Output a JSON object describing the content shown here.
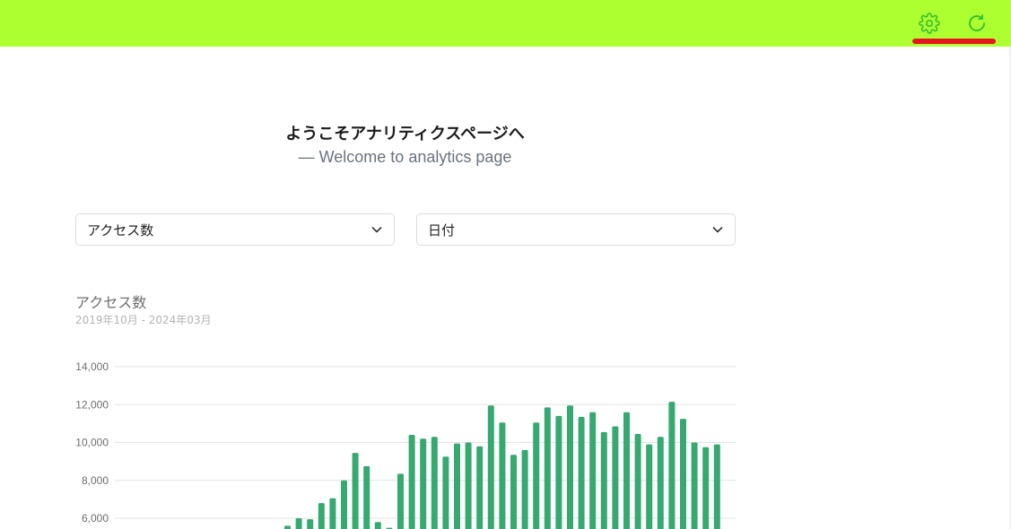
{
  "header": {
    "settings_icon": "gear-icon",
    "refresh_icon": "refresh-icon",
    "bg_color": "#adff2f",
    "icon_color": "#2fbf2f",
    "underline_color": "#e4161b"
  },
  "main": {
    "title": "ようこそアナリティクスページへ",
    "subtitle": "—  Welcome to analytics page"
  },
  "filters": {
    "metric": {
      "selected": "アクセス数",
      "icon": "chevron-down-icon"
    },
    "dimension": {
      "selected": "日付",
      "icon": "chevron-down-icon"
    }
  },
  "chart": {
    "title": "アクセス数",
    "period": "2019年10月 - 2024年03月"
  },
  "chart_data": {
    "type": "bar",
    "color": "#35a96f",
    "y_ticks": [
      "6,000",
      "8,000",
      "10,000",
      "12,000",
      "14,000"
    ],
    "y_tick_values": [
      6000,
      8000,
      10000,
      12000,
      14000
    ],
    "visible_range": [
      5400,
      14300
    ],
    "values": [
      null,
      null,
      null,
      null,
      null,
      null,
      null,
      null,
      null,
      null,
      null,
      null,
      null,
      null,
      null,
      5600,
      6000,
      5950,
      6800,
      7050,
      8000,
      9450,
      8750,
      5800,
      5500,
      8350,
      10400,
      10200,
      10300,
      9250,
      9950,
      10000,
      9800,
      11950,
      11050,
      9350,
      9600,
      11050,
      11850,
      11400,
      11950,
      11350,
      11600,
      10550,
      10850,
      11600,
      10450,
      9900,
      10300,
      12150,
      11250,
      10000,
      9750,
      9900
    ],
    "grid": true
  }
}
